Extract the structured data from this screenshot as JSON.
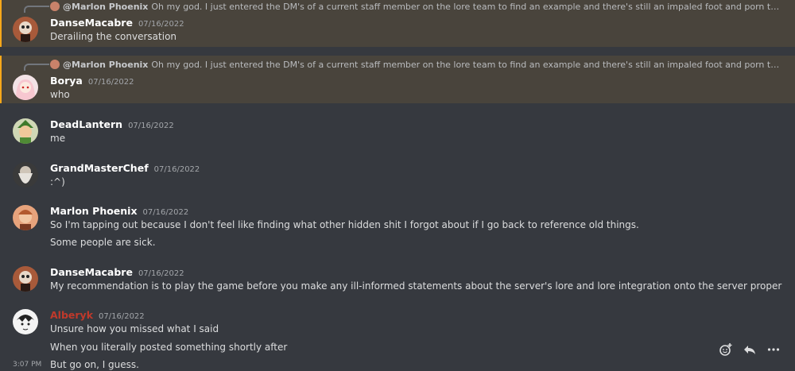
{
  "messages": [
    {
      "reply": {
        "name": "@Marlon Phoenix",
        "text": "Oh my god. I just entered the DM's of a current staff member on the lore team to find an example and there's still an impaled foot and porn that they sent me y..."
      },
      "author": "DanseMacabre",
      "timestamp": "07/16/2022",
      "lines": [
        "Derailing the conversation"
      ]
    },
    {
      "reply": {
        "name": "@Marlon Phoenix",
        "text": "Oh my god. I just entered the DM's of a current staff member on the lore team to find an example and there's still an impaled foot and porn that they sent me y..."
      },
      "author": "Borya",
      "timestamp": "07/16/2022",
      "lines": [
        "who"
      ]
    },
    {
      "author": "DeadLantern",
      "timestamp": "07/16/2022",
      "lines": [
        "me"
      ]
    },
    {
      "author": "GrandMasterChef",
      "timestamp": "07/16/2022",
      "lines": [
        ":^)"
      ]
    },
    {
      "author": "Marlon Phoenix",
      "timestamp": "07/16/2022",
      "lines": [
        "So I'm tapping out because I don't feel like finding what other hidden shit I forgot about if I go back to reference old things.",
        "Some people are sick."
      ]
    },
    {
      "author": "DanseMacabre",
      "timestamp": "07/16/2022",
      "lines": [
        "My recommendation is to play the game before you make any ill-informed statements about the server's lore and lore integration onto the server proper"
      ]
    },
    {
      "author": "Alberyk",
      "author_color": "#c0392b",
      "timestamp": "07/16/2022",
      "lines": [
        "Unsure how you missed what I said",
        "When you literally posted something shortly after",
        "But go on, I guess."
      ],
      "hover_time": "3:07 PM"
    }
  ],
  "toolbar": {
    "icons": [
      "add-reaction-icon",
      "reply-icon",
      "more-icon"
    ]
  },
  "colors": {
    "background": "#36393f",
    "mention_bg": "#49443c",
    "mention_bar": "#faa81a",
    "username_red": "#c0392b"
  }
}
